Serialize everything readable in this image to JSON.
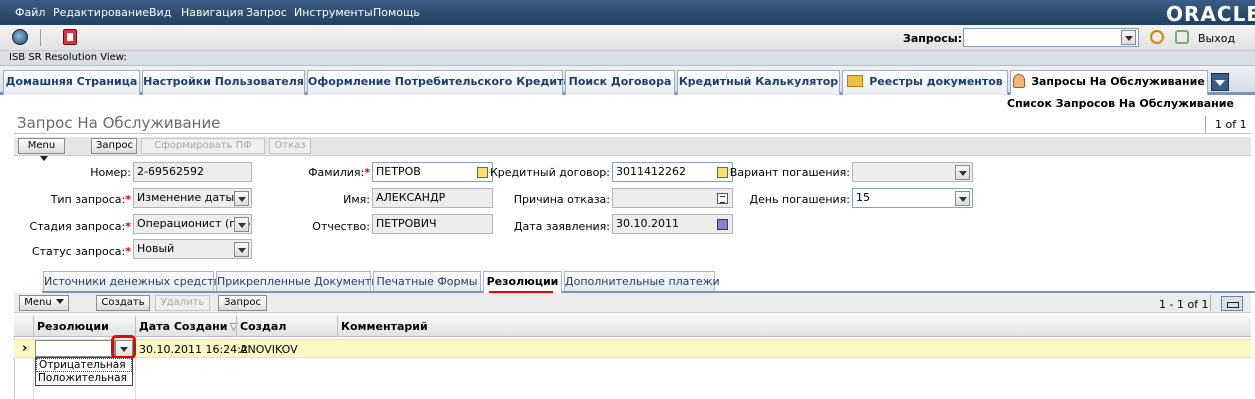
{
  "menu": [
    "Файл",
    "Редактирование",
    "Вид",
    "Навигация",
    "Запрос",
    "Инструменты",
    "Помощь"
  ],
  "logo_text": "ORACLE",
  "toolbar": {
    "queries_label": "Запросы:",
    "queries_value": "",
    "exit_label": "Выход"
  },
  "view_title": "ISB SR Resolution View:",
  "tabs": [
    {
      "label": "Домашняя Страница"
    },
    {
      "label": "Настройки Пользователя"
    },
    {
      "label": "Оформление Потребительского Кредита"
    },
    {
      "label": "Поиск Договора"
    },
    {
      "label": "Кредитный Калькулятор"
    },
    {
      "label": "Реестры документов"
    },
    {
      "label": "Запросы На Обслуживание"
    }
  ],
  "sublink": "Список Запросов На Обслуживание",
  "form": {
    "title": "Запрос На Обслуживание",
    "pager": "1 of 1",
    "buttons": {
      "menu": "Menu",
      "query": "Запрос",
      "form_pf": "Сформировать ПФ",
      "reject": "Отказ"
    },
    "fields": {
      "number": {
        "label": "Номер:",
        "value": "2-69562592"
      },
      "type": {
        "label": "Тип запроса:",
        "value": "Изменение даты п"
      },
      "stage": {
        "label": "Стадия запроса:",
        "value": "Операционист (пер"
      },
      "status": {
        "label": "Статус запроса:",
        "value": "Новый"
      },
      "lastname": {
        "label": "Фамилия:",
        "value": "ПЕТРОВ"
      },
      "firstname": {
        "label": "Имя:",
        "value": "АЛЕКСАНДР"
      },
      "patronymic": {
        "label": "Отчество:",
        "value": "ПЕТРОВИЧ"
      },
      "contract": {
        "label": "Кредитный договор:",
        "value": "3011412262"
      },
      "reject_reason": {
        "label": "Причина отказа:",
        "value": ""
      },
      "app_date": {
        "label": "Дата заявления:",
        "value": "30.10.2011"
      },
      "repay_variant": {
        "label": "Вариант погашения:",
        "value": ""
      },
      "repay_day": {
        "label": "День погашения:",
        "value": "15"
      }
    }
  },
  "subtabs": [
    "Источники денежных средств",
    "Прикрепленные Документы",
    "Печатные Формы",
    "Резолюции",
    "Дополнительные платежи"
  ],
  "list": {
    "buttons": {
      "menu": "Menu",
      "create": "Создать",
      "delete": "Удалить",
      "query": "Запрос"
    },
    "pager": "1 - 1 of 1",
    "columns": [
      "Резолюции",
      "Дата Создани",
      "Создал",
      "Комментарий"
    ],
    "row": {
      "resolution": "",
      "created": "30.10.2011 16:24:2",
      "author": "ANOVIKOV",
      "comment": ""
    },
    "dropdown": [
      "Отрицательная",
      "Положительная"
    ]
  },
  "colors": {
    "menubar": "#2c4a6e",
    "selected_row": "#fbf8c4",
    "highlight": "#e00"
  }
}
